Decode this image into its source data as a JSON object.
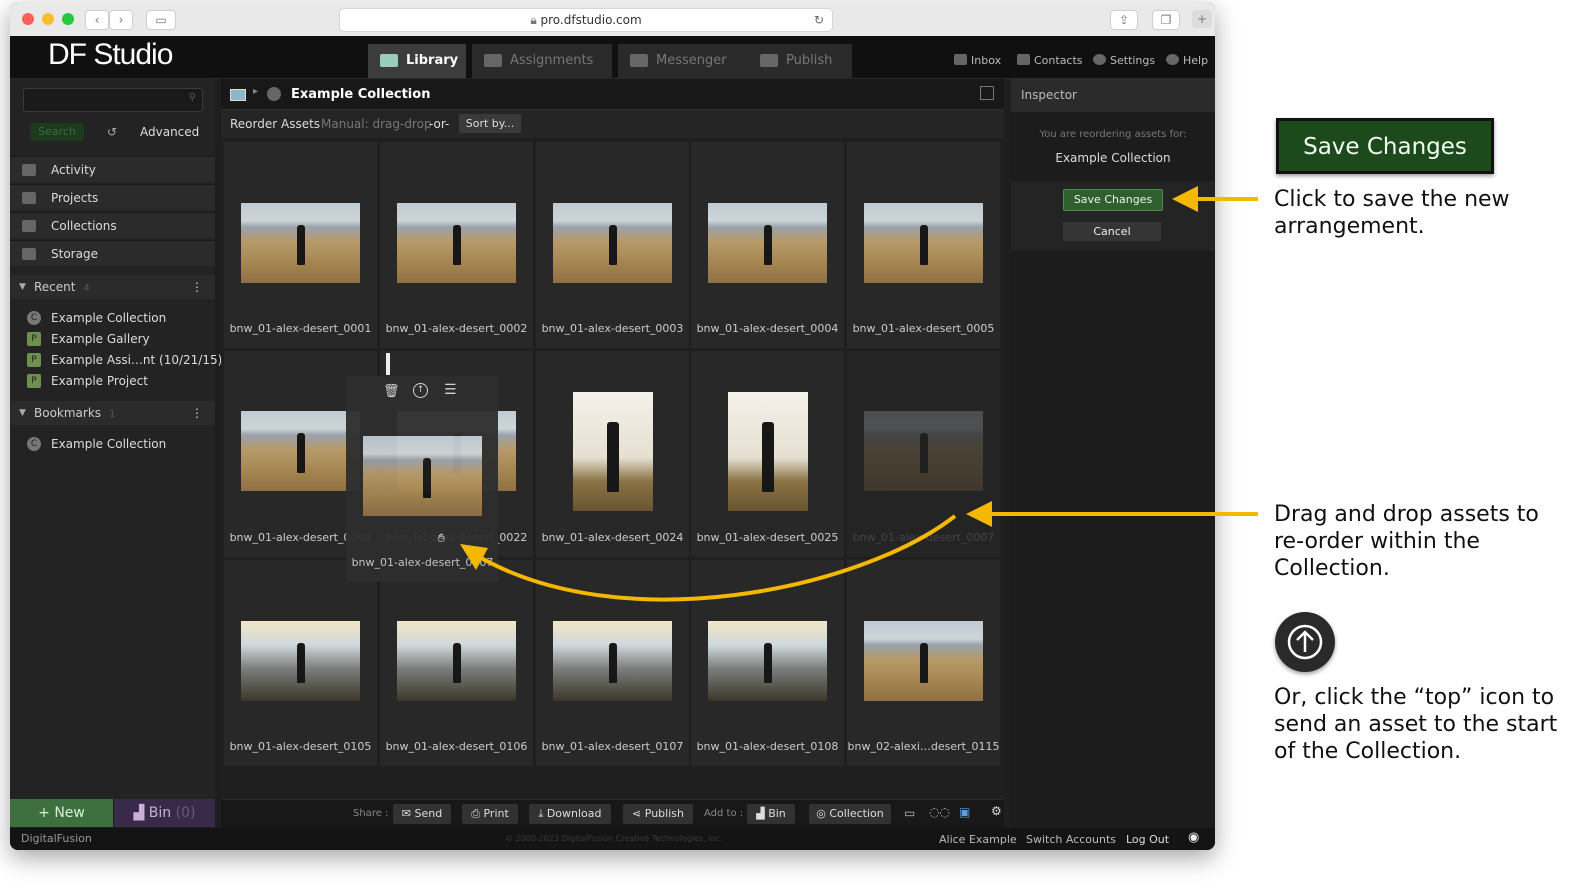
{
  "browser": {
    "url": "pro.dfstudio.com"
  },
  "app": {
    "logo": "DF Studio",
    "tabs": [
      {
        "label": "Library",
        "active": true
      },
      {
        "label": "Assignments"
      },
      {
        "label": "Messenger"
      },
      {
        "label": "Publish"
      }
    ],
    "top_links": [
      "Inbox",
      "Contacts",
      "Settings",
      "Help"
    ]
  },
  "sidebar": {
    "search_label": "Search",
    "advanced_label": "Advanced",
    "nav": [
      "Activity",
      "Projects",
      "Collections",
      "Storage"
    ],
    "recent": {
      "label": "Recent",
      "count": "4",
      "items": [
        {
          "badge": "C",
          "label": "Example Collection"
        },
        {
          "badge": "P",
          "label": "Example Gallery"
        },
        {
          "badge": "P",
          "label": "Example Assi…nt (10/21/15)"
        },
        {
          "badge": "P",
          "label": "Example Project"
        }
      ]
    },
    "bookmarks": {
      "label": "Bookmarks",
      "count": "1",
      "items": [
        {
          "badge": "C",
          "label": "Example Collection"
        }
      ]
    },
    "new_label": "New",
    "bin_label": "Bin",
    "bin_count": "0"
  },
  "main": {
    "breadcrumb_title": "Example Collection",
    "reorder_label": "Reorder Assets",
    "reorder_mode": "Manual: drag-drop",
    "or_label": "-or-",
    "sort_label": "Sort by...",
    "assets": [
      "bnw_01-alex-desert_0001",
      "bnw_01-alex-desert_0002",
      "bnw_01-alex-desert_0003",
      "bnw_01-alex-desert_0004",
      "bnw_01-alex-desert_0005",
      "bnw_01-alex-desert_0006",
      "bnw_01-alex-desert_0022",
      "bnw_01-alex-desert_0024",
      "bnw_01-alex-desert_0025",
      "bnw_01-alex-desert_0007",
      "bnw_01-alex-desert_0105",
      "bnw_01-alex-desert_0106",
      "bnw_01-alex-desert_0107",
      "bnw_01-alex-desert_0108",
      "bnw_02-alexi…desert_0115"
    ],
    "dragging_label": "bnw_01-alex-desert_0007",
    "toolbar": {
      "share_label": "Share :",
      "send": "Send",
      "print": "Print",
      "download": "Download",
      "publish": "Publish",
      "addto_label": "Add to :",
      "bin": "Bin",
      "collection": "Collection"
    }
  },
  "inspector": {
    "title": "Inspector",
    "note": "You are reordering assets for:",
    "collection": "Example Collection",
    "save": "Save Changes",
    "cancel": "Cancel"
  },
  "footer": {
    "brand": "DigitalFusion",
    "copyright": "© 2000-2023 DigitalFusion Creative Technologies, Inc.",
    "user": "Alice Example",
    "switch": "Switch Accounts",
    "logout": "Log Out"
  },
  "annotations": {
    "save_big": "Save Changes",
    "save_text": "Click to save the new arrangement.",
    "drag_text": "Drag and drop assets to re-order within the Collection.",
    "top_text": "Or, click the “top” icon to send an asset to the start of the Collection.",
    "arrow_color": "#f5b800"
  }
}
